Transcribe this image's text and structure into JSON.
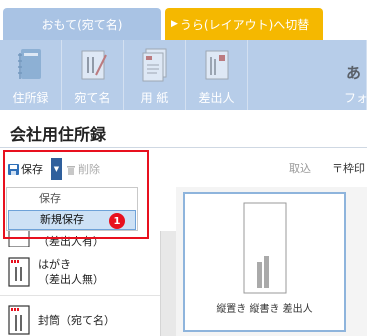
{
  "tabs": {
    "front": "おもて(宛て名)",
    "back": "うら(レイアウト)へ切替"
  },
  "ribbon": {
    "items": [
      {
        "label": "住所録",
        "icon": "address-book-icon"
      },
      {
        "label": "宛て名",
        "icon": "addressee-icon"
      },
      {
        "label": "用 紙",
        "icon": "paper-icon"
      },
      {
        "label": "差出人",
        "icon": "sender-icon"
      },
      {
        "label": "フォ",
        "icon": "font-icon"
      }
    ]
  },
  "page": {
    "title": "会社用住所録"
  },
  "toolbar": {
    "save_label": "保存",
    "delete_label": "削除",
    "import_label": "取込",
    "frame_label": "〒枠印"
  },
  "menu": {
    "items": [
      "保存",
      "新規保存"
    ]
  },
  "badge": "1",
  "list": {
    "partial_item": "（差出人有）",
    "items": [
      {
        "line1": "はがき",
        "line2": "（差出人無）"
      },
      {
        "line1": "封筒（宛て名）",
        "line2": ""
      }
    ]
  },
  "preview": {
    "label": "縦置き 縦書き 差出人"
  },
  "colors": {
    "accent": "#2f5f9c",
    "ribbon": "#b7cde9",
    "highlight": "#e8101e",
    "tab_back": "#f5b800"
  }
}
